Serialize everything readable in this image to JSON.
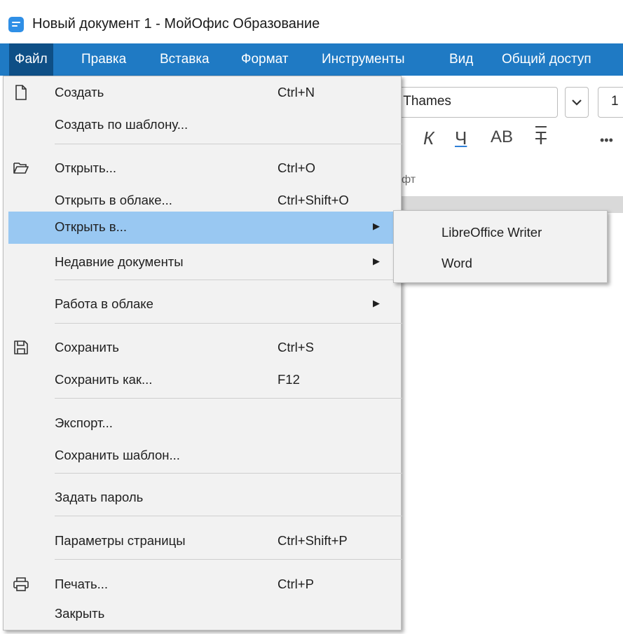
{
  "window": {
    "title": "Новый документ 1 - МойОфис Образование"
  },
  "menubar": {
    "items": [
      {
        "label": "Файл",
        "active": true
      },
      {
        "label": "Правка"
      },
      {
        "label": "Вставка"
      },
      {
        "label": "Формат"
      },
      {
        "label": "Инструменты"
      },
      {
        "label": "Вид"
      },
      {
        "label": "Общий доступ"
      }
    ]
  },
  "toolbar": {
    "font_name": ") Thames",
    "font_size": "1",
    "format_buttons": [
      {
        "label": "К",
        "icon": "italic-icon"
      },
      {
        "label": "Ч",
        "icon": "underline-icon"
      },
      {
        "label": "АВ",
        "icon": "caps-icon"
      },
      {
        "label": "Т",
        "icon": "strikethrough-icon"
      },
      {
        "label": "•••",
        "icon": "more-icon"
      }
    ],
    "group_label": "ифт"
  },
  "file_menu": {
    "items": [
      {
        "label": "Создать",
        "shortcut": "Ctrl+N",
        "icon": "new-document-icon"
      },
      {
        "label": "Создать по шаблону..."
      },
      {
        "label": "Открыть...",
        "shortcut": "Ctrl+O",
        "icon": "folder-open-icon"
      },
      {
        "label": "Открыть в облаке...",
        "shortcut": "Ctrl+Shift+O"
      },
      {
        "label": "Открыть в...",
        "submenu": true,
        "highlighted": true
      },
      {
        "label": "Недавние документы",
        "submenu": true
      },
      {
        "label": "Работа в облаке",
        "submenu": true
      },
      {
        "label": "Сохранить",
        "shortcut": "Ctrl+S",
        "icon": "save-icon"
      },
      {
        "label": "Сохранить как...",
        "shortcut": "F12"
      },
      {
        "label": "Экспорт..."
      },
      {
        "label": "Сохранить шаблон..."
      },
      {
        "label": "Задать пароль"
      },
      {
        "label": "Параметры страницы",
        "shortcut": "Ctrl+Shift+P"
      },
      {
        "label": "Печать...",
        "shortcut": "Ctrl+P",
        "icon": "printer-icon"
      },
      {
        "label": "Закрыть"
      }
    ]
  },
  "submenu": {
    "items": [
      {
        "label": "LibreOffice Writer"
      },
      {
        "label": "Word"
      }
    ]
  },
  "colors": {
    "menubar_bg": "#1f7ac4",
    "menubar_active_bg": "#0e4f86",
    "highlight_bg": "#99c8f2",
    "menu_bg": "#f2f2f2",
    "app_icon": "#2f8fe6"
  }
}
